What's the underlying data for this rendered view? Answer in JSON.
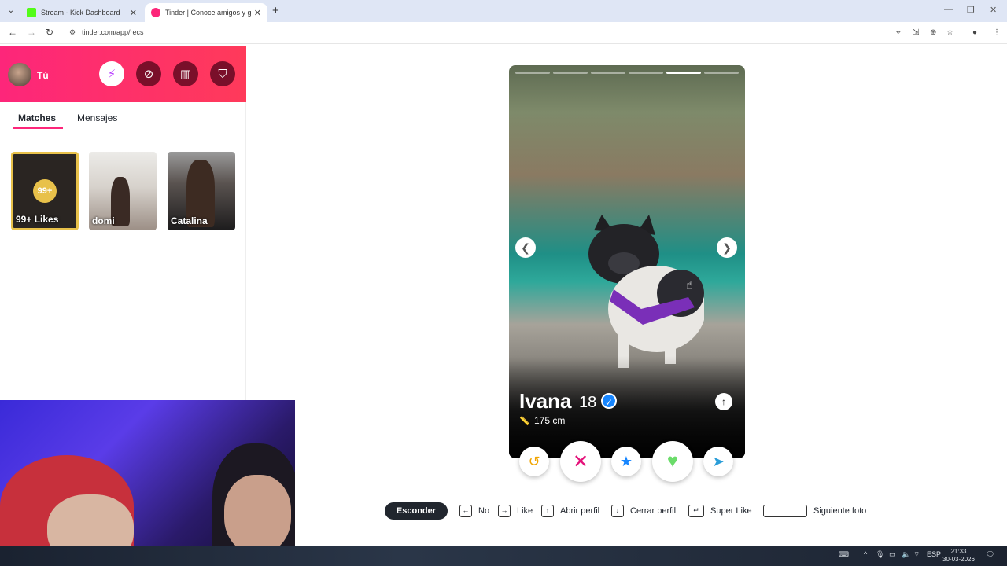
{
  "browser": {
    "tabs": [
      {
        "title": "Stream - Kick Dashboard",
        "fav_color": "#53fc18"
      },
      {
        "title": "Tinder | Conoce amigos y gente",
        "fav_color": "#fd267a"
      }
    ],
    "url": "tinder.com/app/recs"
  },
  "sidebar": {
    "user_label": "Tú",
    "tabs": [
      "Matches",
      "Mensajes"
    ],
    "likes_badge": "99+",
    "likes_label": "99+ Likes",
    "matches": [
      {
        "name": "domi"
      },
      {
        "name": "Catalina"
      }
    ],
    "header_icons": [
      "lightning-icon",
      "compass-icon",
      "briefcase-icon",
      "shield-icon"
    ]
  },
  "profile": {
    "name": "Ivana",
    "age": "18",
    "height": "175 cm",
    "photo_index": 5,
    "photo_count": 6
  },
  "actions": [
    "rewind-icon",
    "nope-icon",
    "super-like-icon",
    "like-icon",
    "boost-icon"
  ],
  "shortcuts": {
    "hide_label": "Esconder",
    "no": "No",
    "like": "Like",
    "open_profile": "Abrir perfil",
    "close_profile": "Cerrar perfil",
    "super_like": "Super Like",
    "next_photo": "Siguiente foto"
  },
  "taskbar": {
    "lang": "ESP",
    "time": "21:33",
    "date": "30-03-2026"
  },
  "colors": {
    "brand": "#fd267a",
    "like": "#6bdc6a",
    "superlike": "#1786ff"
  }
}
